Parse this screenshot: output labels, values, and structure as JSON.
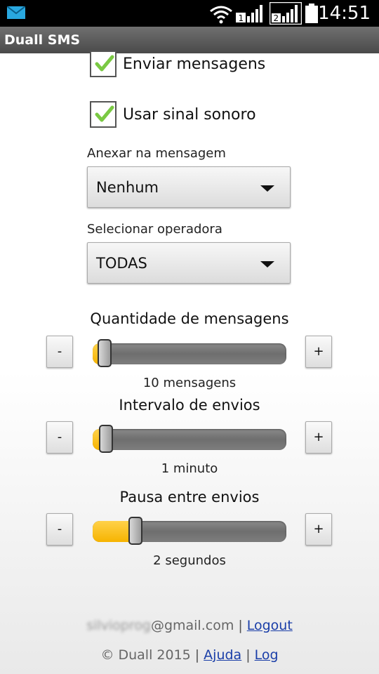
{
  "status_bar": {
    "time": "14:51",
    "sim1_label": "1",
    "sim2_label": "2",
    "icons": [
      "mail-icon",
      "wifi-icon",
      "signal-sim1-icon",
      "signal-sim2-icon",
      "battery-icon"
    ]
  },
  "app": {
    "title": "Duall SMS"
  },
  "options": {
    "send_messages": {
      "label": "Enviar mensagens",
      "checked": true
    },
    "use_sound": {
      "label": "Usar sinal sonoro",
      "checked": true
    }
  },
  "attach": {
    "label": "Anexar na mensagem",
    "value": "Nenhum"
  },
  "operator": {
    "label": "Selecionar operadora",
    "value": "TODAS"
  },
  "sliders": {
    "quantity": {
      "title": "Quantidade de mensagens",
      "value_text": "10 mensagens",
      "fraction": 0.06,
      "minus": "-",
      "plus": "+"
    },
    "interval": {
      "title": "Intervalo de envios",
      "value_text": "1 minuto",
      "fraction": 0.07,
      "minus": "-",
      "plus": "+"
    },
    "pause": {
      "title": "Pausa entre envios",
      "value_text": "2 segundos",
      "fraction": 0.22,
      "minus": "-",
      "plus": "+"
    }
  },
  "footer": {
    "email_user": "silvioprog",
    "email_domain": "@gmail.com",
    "separator": "|",
    "logout": "Logout",
    "copyright": "© Duall 2015",
    "help": "Ajuda",
    "log": "Log"
  },
  "colors": {
    "accent_fill": "#f6b400",
    "link": "#1a3ea8",
    "check": "#7ac943"
  }
}
